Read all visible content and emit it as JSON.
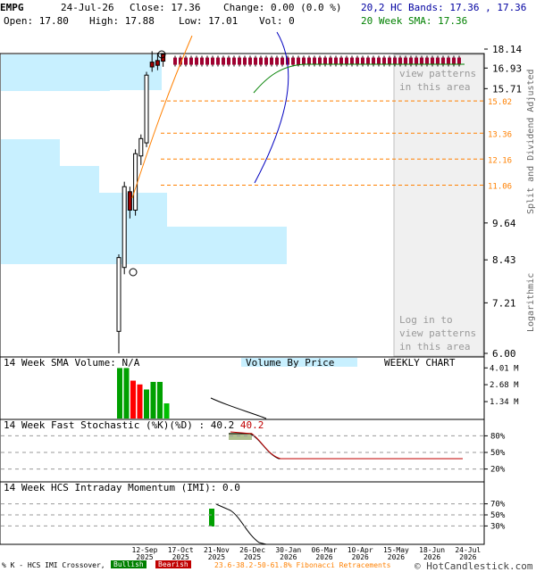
{
  "header": {
    "symbol": "EMPG",
    "date": "24-Jul-26",
    "close": "Close: 17.36",
    "change": "Change: 0.00 (0.0 %)",
    "open": "Open: 17.80",
    "high": "High: 17.88",
    "low": "Low: 17.01",
    "vol": "Vol: 0",
    "bands": "20,2 HC Bands: 17.36 , 17.36",
    "sma": "20 Week SMA: 17.36"
  },
  "colors": {
    "up": "#000000",
    "down": "#a00000",
    "bands": "#0000a0",
    "sma": "#008000",
    "vbp": "#c8f0ff",
    "fib": "#ff8000",
    "bull": "#008000",
    "bear": "#c00000"
  },
  "price_panel": {
    "y_ticks": [
      "18.14",
      "16.93",
      "15.71",
      "9.64",
      "8.43",
      "7.21",
      "6.00"
    ],
    "right_label_top": "Split and Dividend Adjusted",
    "right_label_bottom": "Logarithmic",
    "watermark_top": "view patterns in this area",
    "watermark_bottom": "Log in to view patterns in this area",
    "fib_labels": [
      "15.02",
      "13.36",
      "12.16",
      "11.06"
    ]
  },
  "volume_panel": {
    "title": "14 Week SMA Volume: N/A",
    "vbp_label": "Volume By Price",
    "chart_label": "WEEKLY CHART",
    "y_ticks": [
      "4.01 M",
      "2.68 M",
      "1.34 M"
    ]
  },
  "stoch_panel": {
    "title": "14 Week Fast Stochastic (%K)(%D) : 40.2",
    "title_val": "40.2",
    "y_ticks": [
      "80%",
      "50%",
      "20%"
    ]
  },
  "imi_panel": {
    "title": "14 Week HCS Intraday Momentum (IMI): 0.0",
    "y_ticks": [
      "70%",
      "50%",
      "30%"
    ]
  },
  "x_axis": {
    "labels": [
      {
        "d": "12-Sep",
        "y": "2025"
      },
      {
        "d": "17-Oct",
        "y": "2025"
      },
      {
        "d": "21-Nov",
        "y": "2025"
      },
      {
        "d": "26-Dec",
        "y": "2025"
      },
      {
        "d": "30-Jan",
        "y": "2026"
      },
      {
        "d": "06-Mar",
        "y": "2026"
      },
      {
        "d": "10-Apr",
        "y": "2026"
      },
      {
        "d": "15-May",
        "y": "2026"
      },
      {
        "d": "18-Jun",
        "y": "2026"
      },
      {
        "d": "24-Jul",
        "y": "2026"
      }
    ]
  },
  "footer": {
    "imi_legend": "% K - HCS IMI Crossover,",
    "bullish": "Bullish",
    "bearish": "Bearish",
    "fib_legend": "23.6-38.2-50-61.8% Fibonacci Retracements",
    "copyright": "© HotCandlestick.com"
  },
  "chart_data": [
    {
      "type": "candlestick",
      "title": "EMPG",
      "scale": "logarithmic",
      "ylim": [
        6.0,
        18.14
      ],
      "y_ticks": [
        18.14,
        16.93,
        15.71,
        9.64,
        8.43,
        7.21,
        6.0
      ],
      "candles": [
        {
          "o": 6.5,
          "h": 8.6,
          "l": 6.0,
          "c": 8.5
        },
        {
          "o": 8.2,
          "h": 11.2,
          "l": 8.0,
          "c": 11.0
        },
        {
          "o": 10.8,
          "h": 11.0,
          "l": 9.8,
          "c": 10.1
        },
        {
          "o": 10.1,
          "h": 12.6,
          "l": 9.9,
          "c": 12.4
        },
        {
          "o": 12.3,
          "h": 13.3,
          "l": 11.9,
          "c": 13.1
        },
        {
          "o": 12.9,
          "h": 16.7,
          "l": 12.7,
          "c": 16.5
        },
        {
          "o": 17.3,
          "h": 18.0,
          "l": 16.7,
          "c": 17.0
        },
        {
          "o": 17.4,
          "h": 17.9,
          "l": 16.8,
          "c": 17.1
        },
        {
          "o": 17.8,
          "h": 17.88,
          "l": 17.01,
          "c": 17.36
        }
      ],
      "flat_close": 17.36,
      "fib_levels": [
        15.02,
        13.36,
        12.16,
        11.06
      ],
      "legend": [
        "20,2 HC Bands: 17.36 , 17.36",
        "20 Week SMA: 17.36"
      ]
    },
    {
      "type": "bar",
      "title": "14 Week SMA Volume: N/A",
      "y_ticks": [
        "4.01 M",
        "2.68 M",
        "1.34 M"
      ],
      "values": [
        4.0,
        4.0,
        3.0,
        2.7,
        2.3,
        2.9,
        2.9,
        1.2
      ]
    },
    {
      "type": "line",
      "title": "14 Week Fast Stochastic (%K)(%D) : 40.2",
      "y_ticks": [
        "80%",
        "50%",
        "20%"
      ],
      "k": [
        80,
        80,
        75,
        42,
        40.2,
        40.2
      ],
      "d": [
        82,
        82,
        78,
        48,
        40.2,
        40.2
      ]
    },
    {
      "type": "line",
      "title": "14 Week HCS Intraday Momentum (IMI): 0.0",
      "y_ticks": [
        "70%",
        "50%",
        "30%"
      ],
      "imi": [
        100,
        95,
        70,
        30,
        0,
        0
      ]
    }
  ]
}
